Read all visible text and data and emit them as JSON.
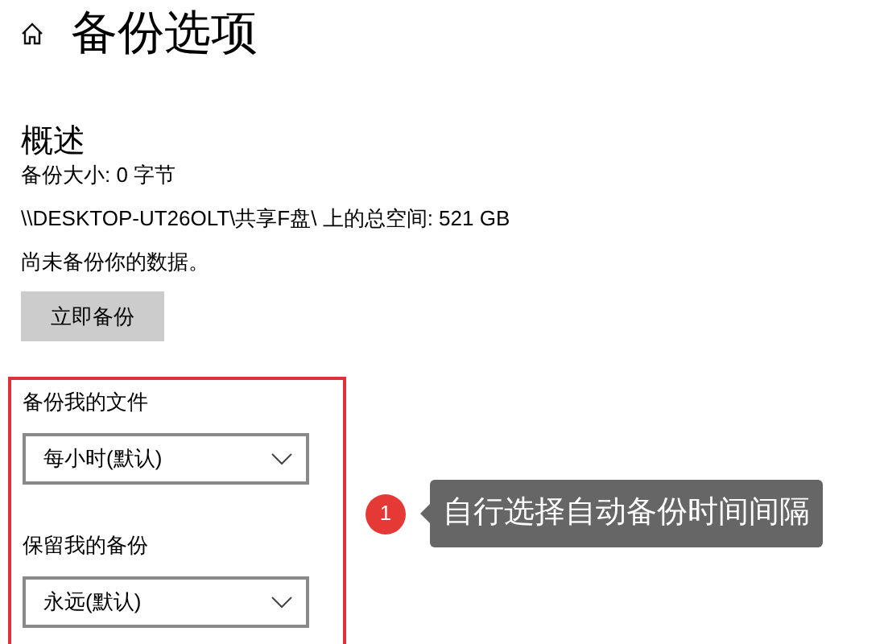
{
  "header": {
    "title": "备份选项"
  },
  "overview": {
    "heading": "概述",
    "lines": [
      "备份大小: 0 字节",
      "\\\\DESKTOP-UT26OLT\\共享F盘\\ 上的总空间: 521 GB",
      "尚未备份你的数据。"
    ],
    "button": "立即备份"
  },
  "settings": [
    {
      "label": "备份我的文件",
      "value": "每小时(默认)"
    },
    {
      "label": "保留我的备份",
      "value": "永远(默认)"
    }
  ],
  "callout": {
    "number": "1",
    "text": "自行选择自动备份时间间隔"
  }
}
